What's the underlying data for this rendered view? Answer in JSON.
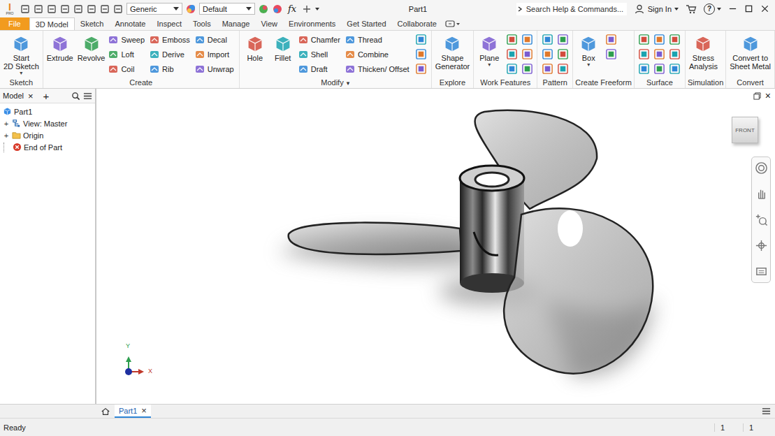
{
  "title_bar": {
    "logo": {
      "mark": "I",
      "edition": "PRO"
    },
    "appearance": "Generic",
    "material": "Default",
    "formula": "fx",
    "document": "Part1",
    "search": {
      "placeholder": "Search Help & Commands..."
    },
    "sign_in": "Sign In",
    "help": "?"
  },
  "ribbon_tabs": [
    {
      "label": "File",
      "selected": false,
      "kind": "file"
    },
    {
      "label": "3D Model",
      "selected": true,
      "kind": "tab"
    },
    {
      "label": "Sketch",
      "selected": false,
      "kind": "tab"
    },
    {
      "label": "Annotate",
      "selected": false,
      "kind": "tab"
    },
    {
      "label": "Inspect",
      "selected": false,
      "kind": "tab"
    },
    {
      "label": "Tools",
      "selected": false,
      "kind": "tab"
    },
    {
      "label": "Manage",
      "selected": false,
      "kind": "tab"
    },
    {
      "label": "View",
      "selected": false,
      "kind": "tab"
    },
    {
      "label": "Environments",
      "selected": false,
      "kind": "tab"
    },
    {
      "label": "Get Started",
      "selected": false,
      "kind": "tab"
    },
    {
      "label": "Collaborate",
      "selected": false,
      "kind": "tab"
    }
  ],
  "ribbon_groups": [
    {
      "label": "Sketch",
      "menu": "",
      "large": [
        {
          "lines": [
            "Start",
            "2D Sketch"
          ],
          "menu": "▾"
        }
      ],
      "small": []
    },
    {
      "label": "Create",
      "menu": "",
      "large": [
        {
          "lines": [
            "Extrude"
          ],
          "menu": ""
        },
        {
          "lines": [
            "Revolve"
          ],
          "menu": ""
        }
      ],
      "small": [
        [
          "Sweep",
          "Loft",
          "Coil"
        ],
        [
          "Emboss",
          "Derive",
          "Rib"
        ],
        [
          "Decal",
          "Import",
          "Unwrap"
        ]
      ]
    },
    {
      "label": "Modify",
      "menu": "▾",
      "large": [
        {
          "lines": [
            "Hole"
          ],
          "menu": ""
        },
        {
          "lines": [
            "Fillet"
          ],
          "menu": ""
        }
      ],
      "small": [
        [
          "Chamfer",
          "Shell",
          "Draft"
        ],
        [
          "Thread",
          "Combine",
          "Thicken/ Offset"
        ]
      ]
    },
    {
      "label": "Explore",
      "menu": "",
      "large": [
        {
          "lines": [
            "Shape",
            "Generator"
          ],
          "menu": ""
        }
      ],
      "small": []
    },
    {
      "label": "Work Features",
      "menu": "",
      "large": [
        {
          "lines": [
            "Plane"
          ],
          "menu": "▾"
        }
      ],
      "small": []
    },
    {
      "label": "Pattern",
      "menu": "",
      "large": [],
      "small": []
    },
    {
      "label": "Create Freeform",
      "menu": "",
      "large": [
        {
          "lines": [
            "Box"
          ],
          "menu": "▾"
        }
      ],
      "small": []
    },
    {
      "label": "Surface",
      "menu": "",
      "large": [],
      "small": []
    },
    {
      "label": "Simulation",
      "menu": "",
      "large": [
        {
          "lines": [
            "Stress",
            "Analysis"
          ],
          "menu": ""
        }
      ],
      "small": []
    },
    {
      "label": "Convert",
      "menu": "",
      "large": [
        {
          "lines": [
            "Convert to",
            "Sheet Metal"
          ],
          "menu": ""
        }
      ],
      "small": []
    }
  ],
  "browser": {
    "title": "Model",
    "close": "×",
    "add": "+",
    "items": [
      {
        "label": "Part1",
        "kind": "root",
        "toggle": ""
      },
      {
        "label": "View: Master",
        "kind": "view",
        "toggle": "+"
      },
      {
        "label": "Origin",
        "kind": "folder",
        "toggle": "+"
      },
      {
        "label": "End of Part",
        "kind": "end",
        "toggle": ""
      }
    ]
  },
  "viewport": {
    "close": "×",
    "view_cube": "FRONT",
    "axes": {
      "y": "Y",
      "x": "X"
    }
  },
  "document_tabs": [
    {
      "label": "Part1",
      "selected": true,
      "close": "×"
    }
  ],
  "status_bar": {
    "text": "Ready",
    "counts": [
      "1",
      "1"
    ]
  }
}
